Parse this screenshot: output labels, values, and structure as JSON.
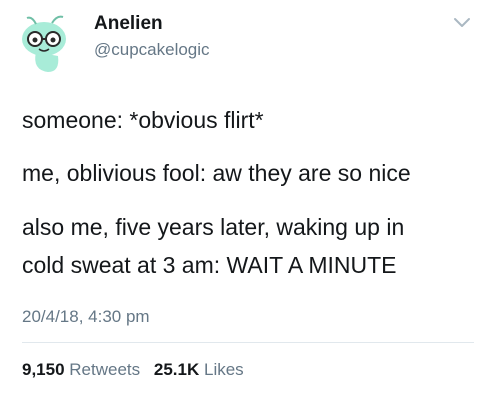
{
  "author": {
    "name": "Anelien",
    "handle": "@cupcakelogic",
    "avatar_icon": "green-alien-with-glasses-avatar"
  },
  "menu_icon": "chevron-down-icon",
  "tweet": {
    "lines": [
      "someone: *obvious flirt*",
      "me, oblivious fool: aw they are so nice",
      "also me, five years later, waking up in",
      "cold sweat at 3 am: WAIT A MINUTE"
    ],
    "timestamp": "20/4/18, 4:30 pm"
  },
  "stats": {
    "retweets_count": "9,150",
    "retweets_label": "Retweets",
    "likes_count": "25.1K",
    "likes_label": "Likes"
  },
  "colors": {
    "text": "#14171a",
    "secondary": "#657786",
    "divider": "#e1e8ed",
    "avatar_green": "#a8ecd8"
  }
}
